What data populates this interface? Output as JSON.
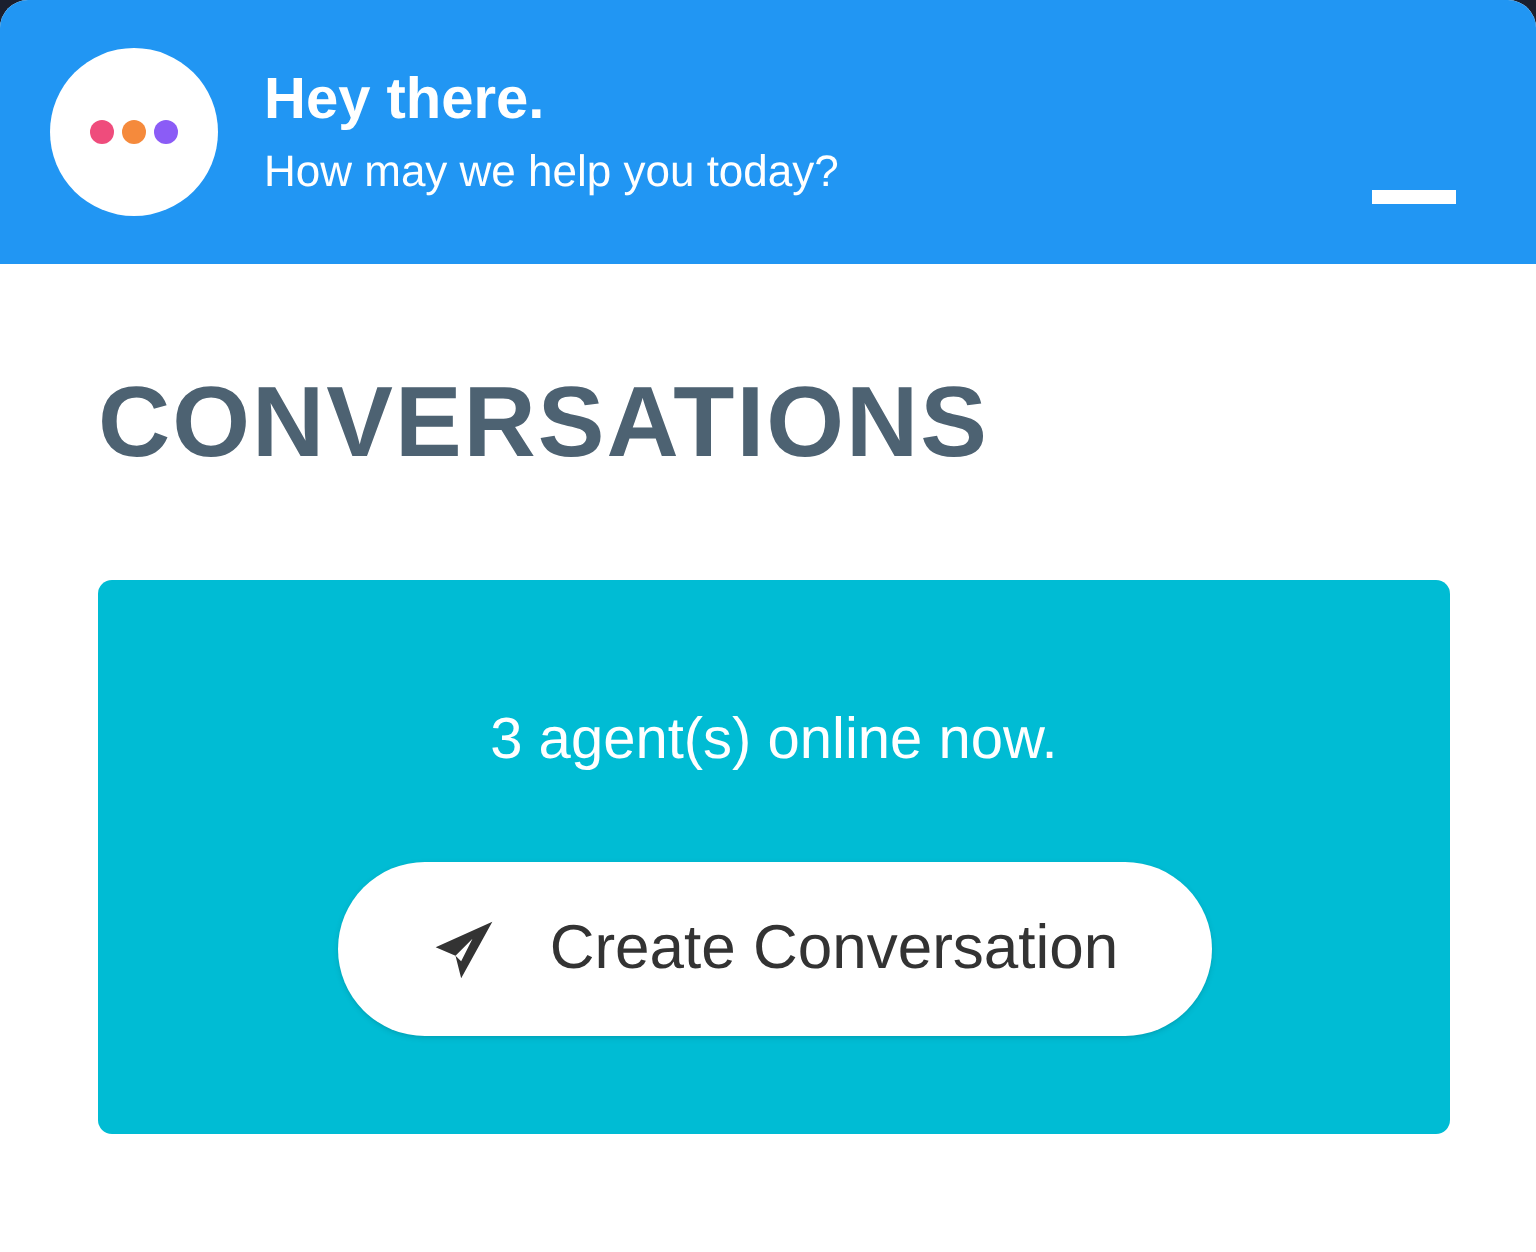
{
  "header": {
    "title": "Hey there.",
    "subtitle": "How may we help you today?"
  },
  "section": {
    "title": "CONVERSATIONS"
  },
  "status_card": {
    "message": "3 agent(s) online now.",
    "button": "Create Conversation"
  }
}
